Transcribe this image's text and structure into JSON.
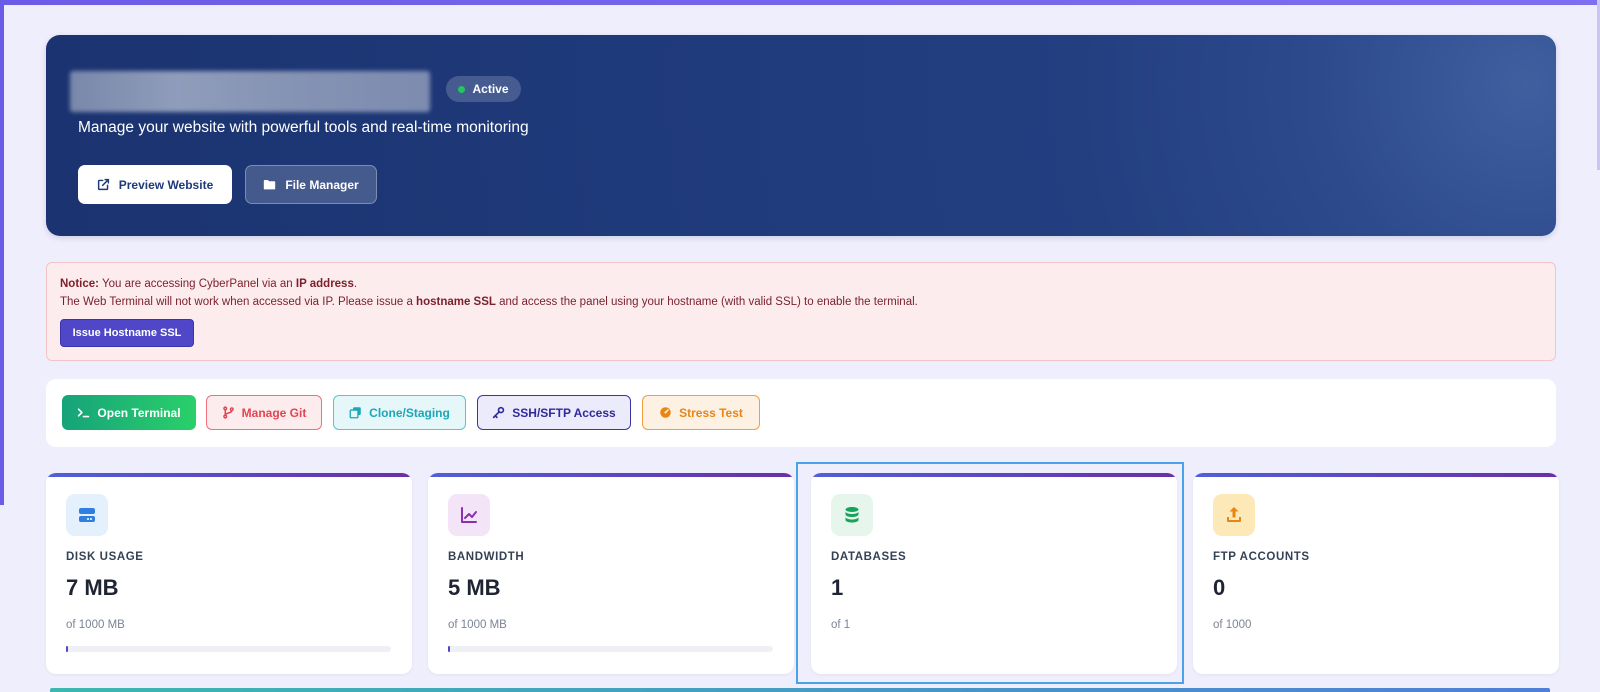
{
  "hero": {
    "status": "Active",
    "subtitle": "Manage your website with powerful tools and real-time monitoring",
    "preview_label": "Preview Website",
    "file_manager_label": "File Manager"
  },
  "notice": {
    "prefix": "Notice:",
    "line1_text": " You are accessing CyberPanel via an ",
    "line1_bold": "IP address",
    "line1_end": ".",
    "line2_a": "The Web Terminal will not work when accessed via IP. Please issue a ",
    "line2_bold": "hostname SSL",
    "line2_b": " and access the panel using your hostname (with valid SSL) to enable the terminal.",
    "button_label": "Issue Hostname SSL"
  },
  "actions": {
    "terminal": "Open Terminal",
    "git": "Manage Git",
    "clone": "Clone/Staging",
    "ssh": "SSH/SFTP Access",
    "stress": "Stress Test"
  },
  "stats": [
    {
      "label": "DISK USAGE",
      "value": "7 MB",
      "of": "of 1000 MB",
      "progress": 0.007,
      "icon": "disk-icon",
      "color": "#2f7fe0"
    },
    {
      "label": "BANDWIDTH",
      "value": "5 MB",
      "of": "of 1000 MB",
      "progress": 0.005,
      "icon": "chart-line-icon",
      "color": "#8a2fb0"
    },
    {
      "label": "DATABASES",
      "value": "1",
      "of": "of 1",
      "icon": "database-icon",
      "color": "#16a35a"
    },
    {
      "label": "FTP ACCOUNTS",
      "value": "0",
      "of": "of 1000",
      "icon": "upload-icon",
      "color": "#e98513"
    }
  ]
}
